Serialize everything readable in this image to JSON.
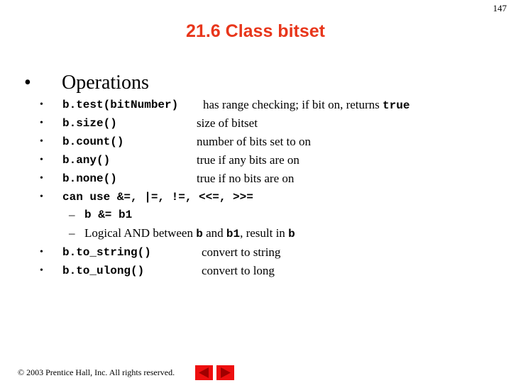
{
  "page_number": "147",
  "title": "21.6  Class bitset",
  "main_bullet": {
    "bullet": "•",
    "label": "Operations"
  },
  "items": [
    {
      "bullet": "•",
      "code": "b.test(bitNumber)",
      "desc_pre": "has range checking; if bit on, returns ",
      "desc_code": "true"
    },
    {
      "bullet": "•",
      "code": "b.size()",
      "desc": "size of bitset"
    },
    {
      "bullet": "•",
      "code": "b.count()",
      "desc": "number of bits set to on"
    },
    {
      "bullet": "•",
      "code": "b.any()",
      "desc": "true if any bits are on"
    },
    {
      "bullet": "•",
      "code": "b.none()",
      "desc": "true if no bits are on"
    },
    {
      "bullet": "•",
      "code": "can use &=, |=, !=, <<=, >>="
    },
    {
      "bullet": "•",
      "code": "b.to_string()",
      "desc": "convert to string"
    },
    {
      "bullet": "•",
      "code": "b.to_ulong()",
      "desc": "convert to long"
    }
  ],
  "sub_items": [
    {
      "dash": "–",
      "code": "b &= b1"
    },
    {
      "dash": "–",
      "text1": "Logical AND between ",
      "code1": "b",
      "text2": " and ",
      "code2": "b1",
      "text3": ", result in ",
      "code3": "b"
    }
  ],
  "footer": {
    "copyright": "© 2003 Prentice Hall, Inc.  All rights reserved.",
    "prev_icon": "triangle-left-icon",
    "next_icon": "triangle-right-icon"
  },
  "colors": {
    "title": "#e8361b",
    "nav_button": "#ee0f0f",
    "nav_arrow": "#a00000"
  }
}
